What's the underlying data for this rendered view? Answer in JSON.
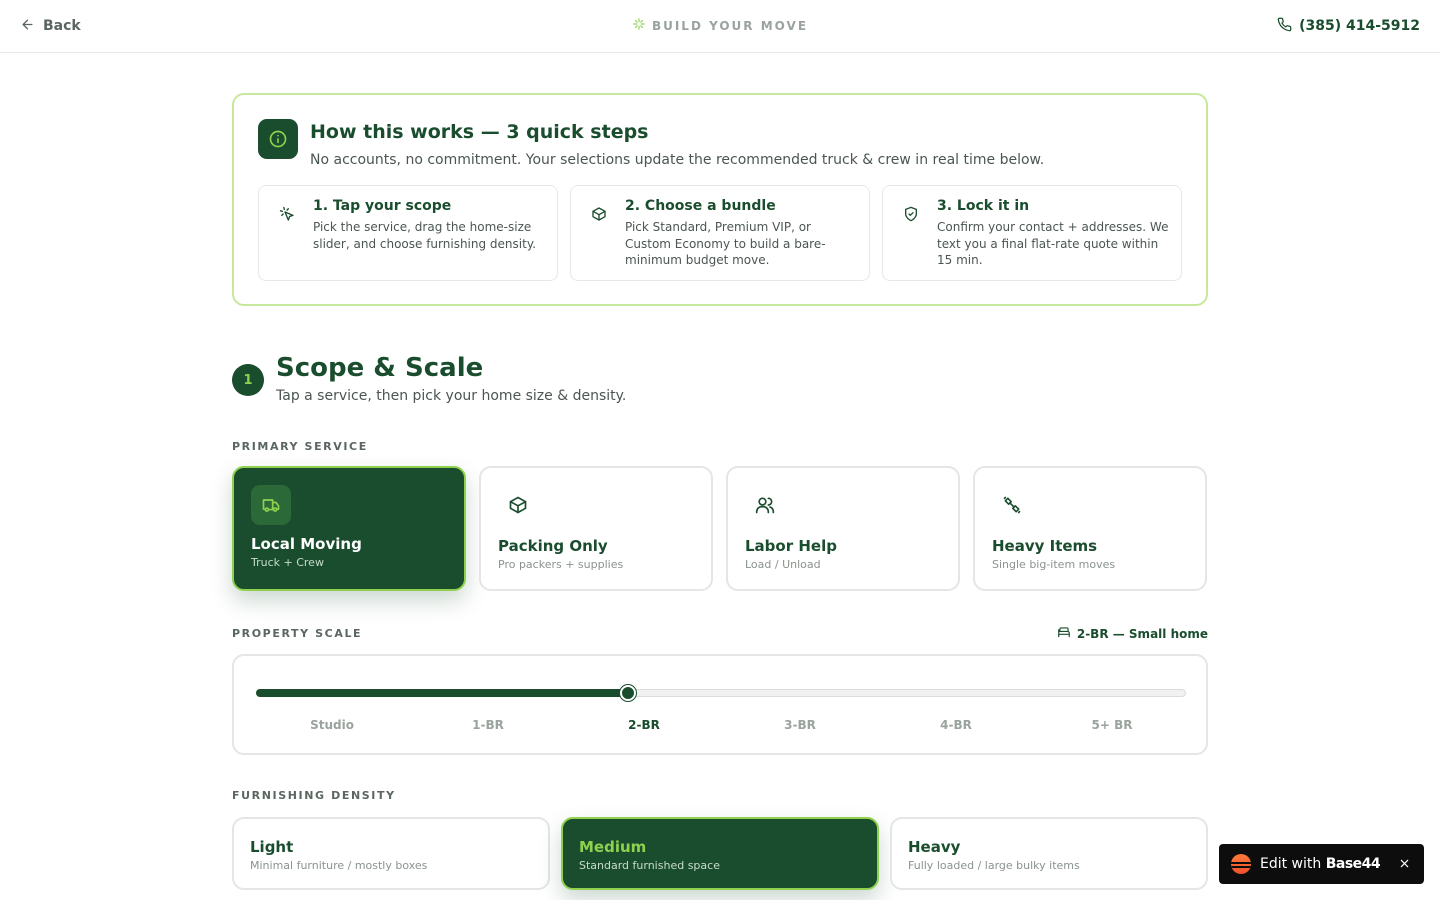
{
  "header": {
    "back_label": "Back",
    "brand_label": "BUILD YOUR MOVE",
    "phone": "(385) 414-5912"
  },
  "info": {
    "title": "How this works — 3 quick steps",
    "subtitle": "No accounts, no commitment. Your selections update the recommended truck & crew in real time below.",
    "steps": [
      {
        "title": "1. Tap your scope",
        "desc": "Pick the service, drag the home-size slider, and choose furnishing density.",
        "icon": "pointer-click-icon"
      },
      {
        "title": "2. Choose a bundle",
        "desc": "Pick Standard, Premium VIP, or Custom Economy to build a bare-minimum budget move.",
        "icon": "package-icon"
      },
      {
        "title": "3. Lock it in",
        "desc": "Confirm your contact + addresses. We text you a final flat-rate quote within 15 min.",
        "icon": "shield-check-icon"
      }
    ]
  },
  "section": {
    "number": "1",
    "title": "Scope & Scale",
    "subtitle": "Tap a service, then pick your home size & density."
  },
  "primary_service": {
    "label": "PRIMARY SERVICE",
    "options": [
      {
        "name": "Local Moving",
        "desc": "Truck + Crew",
        "icon": "truck-icon",
        "selected": true
      },
      {
        "name": "Packing Only",
        "desc": "Pro packers + supplies",
        "icon": "package-icon",
        "selected": false
      },
      {
        "name": "Labor Help",
        "desc": "Load / Unload",
        "icon": "users-icon",
        "selected": false
      },
      {
        "name": "Heavy Items",
        "desc": "Single big-item moves",
        "icon": "dumbbell-icon",
        "selected": false
      }
    ]
  },
  "property_scale": {
    "label": "PROPERTY SCALE",
    "current_value": "2-BR — Small home",
    "ticks": [
      "Studio",
      "1-BR",
      "2-BR",
      "3-BR",
      "4-BR",
      "5+ BR"
    ],
    "selected_index": 2,
    "slider_fraction": 0.4
  },
  "furnishing_density": {
    "label": "FURNISHING DENSITY",
    "options": [
      {
        "name": "Light",
        "desc": "Minimal furniture / mostly boxes",
        "selected": false
      },
      {
        "name": "Medium",
        "desc": "Standard furnished space",
        "selected": true
      },
      {
        "name": "Heavy",
        "desc": "Fully loaded / large bulky items",
        "selected": false
      }
    ]
  },
  "badge": {
    "prefix": "Edit with ",
    "brand": "Base44"
  },
  "colors": {
    "primary": "#1a4d2e",
    "accent": "#8fd14f",
    "border_light": "#e3e6e3"
  }
}
